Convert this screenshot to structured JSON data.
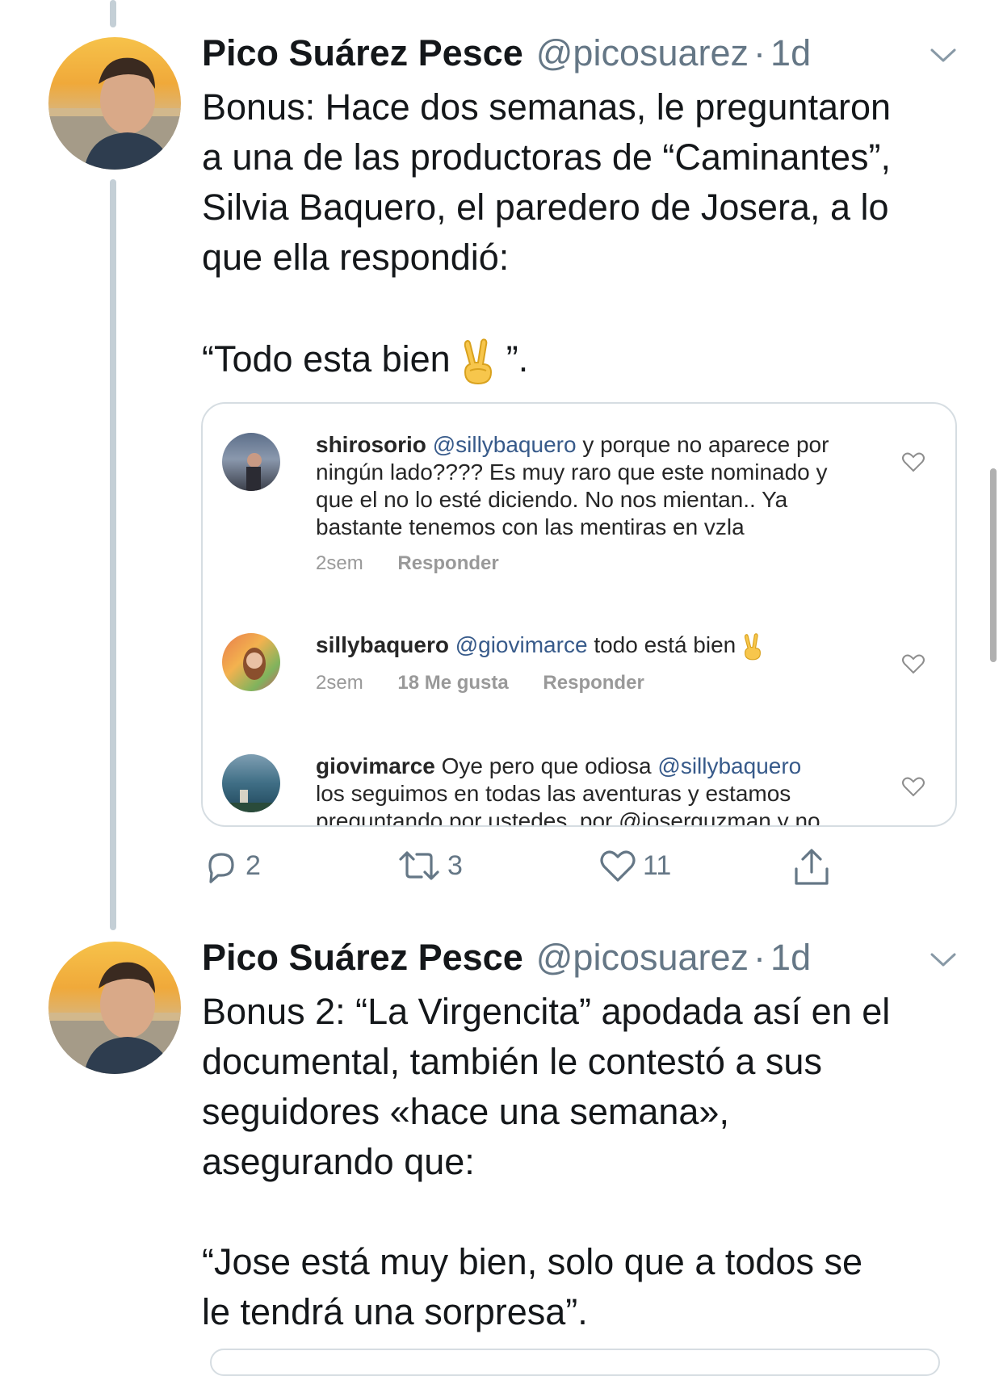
{
  "tweets": [
    {
      "author_name": "Pico Suárez Pesce",
      "handle": "@picosuarez",
      "separator": "·",
      "time": "1d",
      "text_lines": [
        "Bonus: Hace dos semanas, le preguntaron",
        "a una de las productoras de “Caminantes”,",
        "Silvia Baquero, el paredero de Josera, a lo",
        "que ella respondió:"
      ],
      "quote_prefix": "“Todo esta bien",
      "quote_suffix": "”.",
      "actions": {
        "reply_count": "2",
        "retweet_count": "3",
        "like_count": "11"
      }
    },
    {
      "author_name": "Pico Suárez Pesce",
      "handle": "@picosuarez",
      "separator": "·",
      "time": "1d",
      "text_lines": [
        "Bonus 2: “La Virgencita” apodada así en el",
        "documental, también le contestó a sus",
        "seguidores «hace una semana»,",
        "asegurando que:"
      ],
      "quote_lines": [
        "“Jose está muy bien, solo que a todos se",
        "le tendrá una sorpresa”."
      ]
    }
  ],
  "embedded_comments": [
    {
      "username": "shirosorio",
      "mention": "@sillybaquero",
      "line1_rest": "y porque no aparece por",
      "more_lines": [
        "ningún lado???? Es muy raro que este nominado y",
        "que el no lo esté diciendo. No nos mientan.. Ya",
        "bastante tenemos con las mentiras en vzla"
      ],
      "time": "2sem",
      "reply_label": "Responder"
    },
    {
      "username": "sillybaquero",
      "mention": "@giovimarce",
      "line1_rest": "todo está bien",
      "time": "2sem",
      "likes": "18 Me gusta",
      "reply_label": "Responder"
    },
    {
      "username": "giovimarce",
      "line1_rest": "Oye pero que odiosa",
      "mention": "@sillybaquero",
      "more_lines": [
        "los seguimos en todas las aventuras y estamos",
        "preguntando por ustedes, por @joserguzman y no"
      ]
    }
  ],
  "colors": {
    "text": "#14171a",
    "secondary": "#657786",
    "thread_line": "#c4cfd6",
    "mention": "#375a8a",
    "border": "#d6dde2"
  },
  "icons": [
    "reply-icon",
    "retweet-icon",
    "like-icon",
    "share-icon",
    "chevron-down-icon",
    "heart-icon",
    "victory-hand-icon"
  ]
}
